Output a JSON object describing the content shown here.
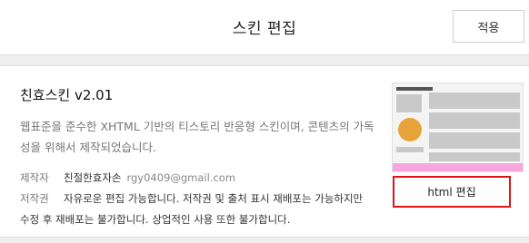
{
  "header": {
    "title": "스킨 편집",
    "apply_label": "적용"
  },
  "skin": {
    "title": "친효스킨 v2.01",
    "description": "웹표준을 준수한 XHTML 기반의 티스토리 반응형 스킨이며, 콘텐츠의 가독성을 위해서 제작되었습니다.",
    "author_label": "제작자",
    "author_name": "친절한효자손",
    "author_email": "rgy0409@gmail.com",
    "copyright_label": "저작권",
    "copyright_text_1": "자유로운 편집 가능합니다. 저작권 및 출처 표시 재배포는 가능하지만",
    "copyright_text_2": "수정 후 재배포는 불가합니다. 상업적인 사용 또한 불가합니다."
  },
  "actions": {
    "html_edit_label": "html 편집"
  },
  "colors": {
    "highlight_border": "#e01414",
    "thumbnail_footer": "#f6a8de"
  }
}
